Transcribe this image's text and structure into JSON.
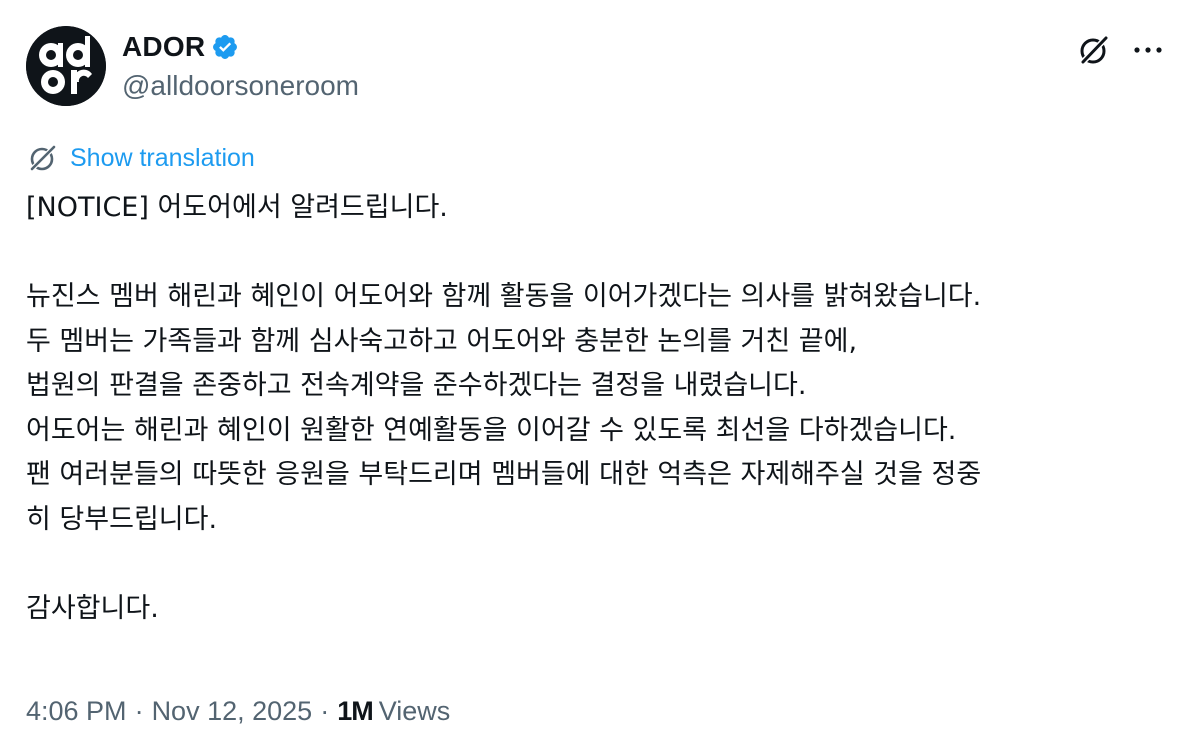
{
  "author": {
    "display_name": "ADOR",
    "handle": "@alldoorsoneroom",
    "avatar_text": "ador",
    "verified": true,
    "verified_color": "#1d9bf0"
  },
  "actions": {
    "grok_icon": "grok-icon",
    "more_icon": "more-icon"
  },
  "translate": {
    "label": "Show translation",
    "icon": "translate-icon",
    "color": "#1d9bf0"
  },
  "post": {
    "lines": [
      "[NOTICE] 어도어에서 알려드립니다.",
      "",
      "뉴진스 멤버 해린과 혜인이 어도어와 함께 활동을 이어가겠다는 의사를 밝혀왔습니다.",
      "두 멤버는 가족들과 함께 심사숙고하고 어도어와 충분한 논의를 거친 끝에,",
      "법원의 판결을 존중하고 전속계약을 준수하겠다는 결정을 내렸습니다.",
      "어도어는 해린과 혜인이 원활한 연예활동을 이어갈 수 있도록 최선을 다하겠습니다.",
      "팬 여러분들의 따뜻한 응원을 부탁드리며 멤버들에 대한 억측은 자제해주실 것을 정중",
      "히 당부드립니다.",
      "",
      "감사합니다."
    ]
  },
  "meta": {
    "time": "4:06 PM",
    "separator": "·",
    "date": "Nov 12, 2025",
    "views_count": "1M",
    "views_label": "Views"
  }
}
